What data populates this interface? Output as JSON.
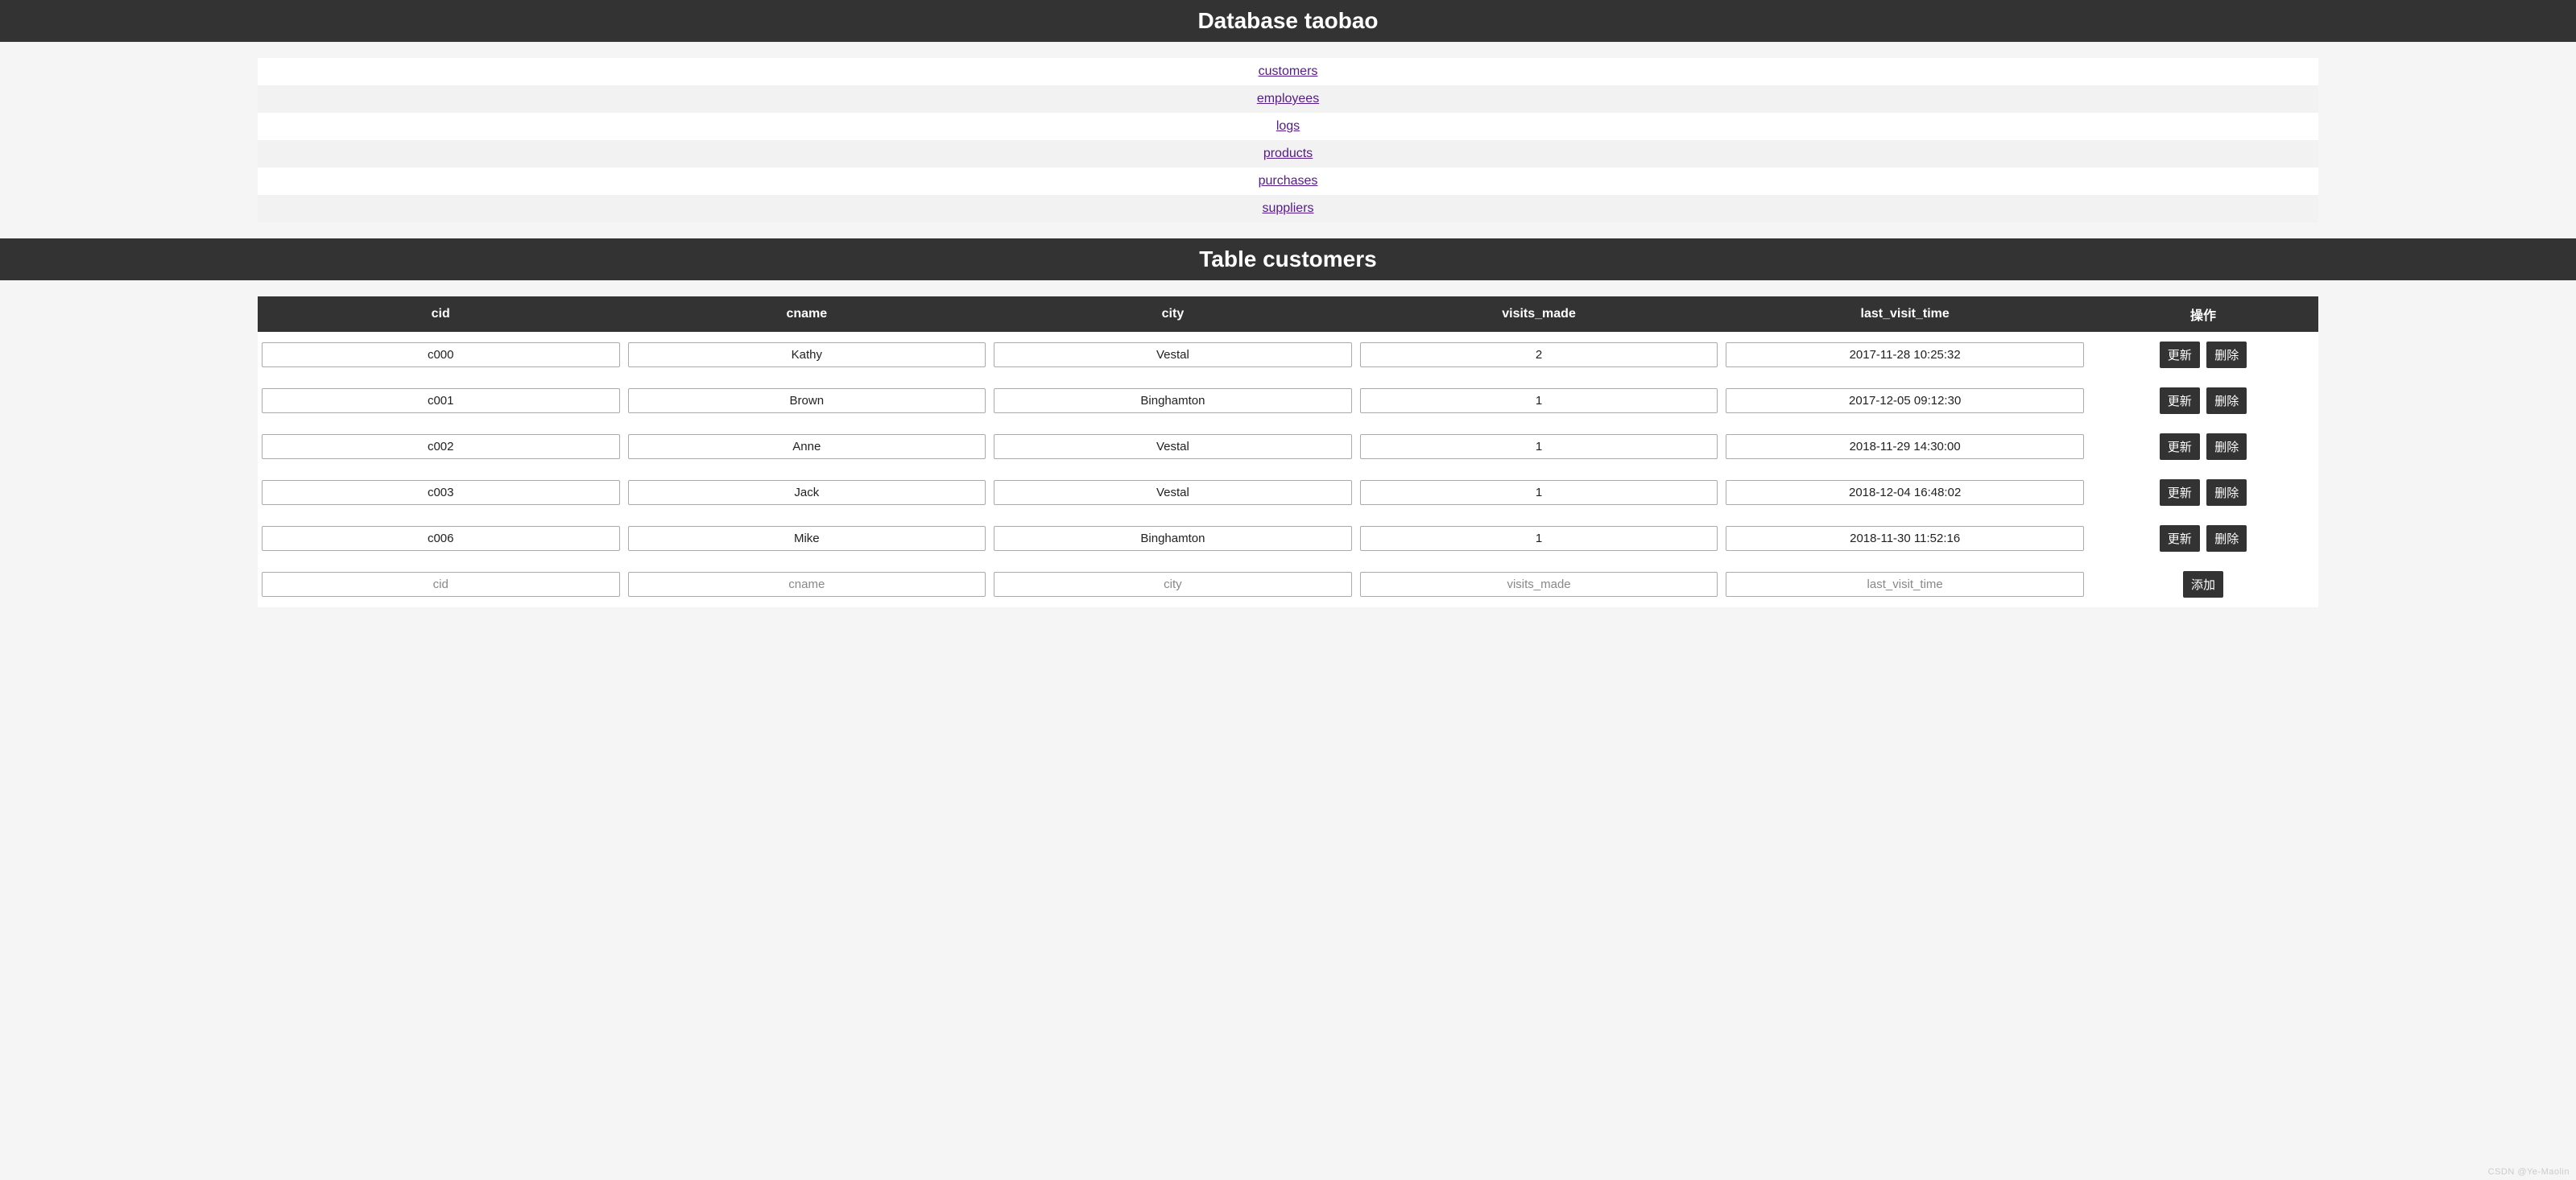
{
  "header": {
    "database_title": "Database taobao",
    "table_title": "Table customers"
  },
  "nav": {
    "items": [
      {
        "label": "customers"
      },
      {
        "label": "employees"
      },
      {
        "label": "logs"
      },
      {
        "label": "products"
      },
      {
        "label": "purchases"
      },
      {
        "label": "suppliers"
      }
    ]
  },
  "table": {
    "headers": {
      "cid": "cid",
      "cname": "cname",
      "city": "city",
      "visits_made": "visits_made",
      "last_visit_time": "last_visit_time",
      "actions": "操作"
    },
    "rows": [
      {
        "cid": "c000",
        "cname": "Kathy",
        "city": "Vestal",
        "visits_made": "2",
        "last_visit_time": "2017-11-28 10:25:32"
      },
      {
        "cid": "c001",
        "cname": "Brown",
        "city": "Binghamton",
        "visits_made": "1",
        "last_visit_time": "2017-12-05 09:12:30"
      },
      {
        "cid": "c002",
        "cname": "Anne",
        "city": "Vestal",
        "visits_made": "1",
        "last_visit_time": "2018-11-29 14:30:00"
      },
      {
        "cid": "c003",
        "cname": "Jack",
        "city": "Vestal",
        "visits_made": "1",
        "last_visit_time": "2018-12-04 16:48:02"
      },
      {
        "cid": "c006",
        "cname": "Mike",
        "city": "Binghamton",
        "visits_made": "1",
        "last_visit_time": "2018-11-30 11:52:16"
      }
    ],
    "placeholders": {
      "cid": "cid",
      "cname": "cname",
      "city": "city",
      "visits_made": "visits_made",
      "last_visit_time": "last_visit_time"
    },
    "buttons": {
      "update": "更新",
      "delete": "删除",
      "add": "添加"
    }
  },
  "watermark": "CSDN @Ye-Maolin"
}
